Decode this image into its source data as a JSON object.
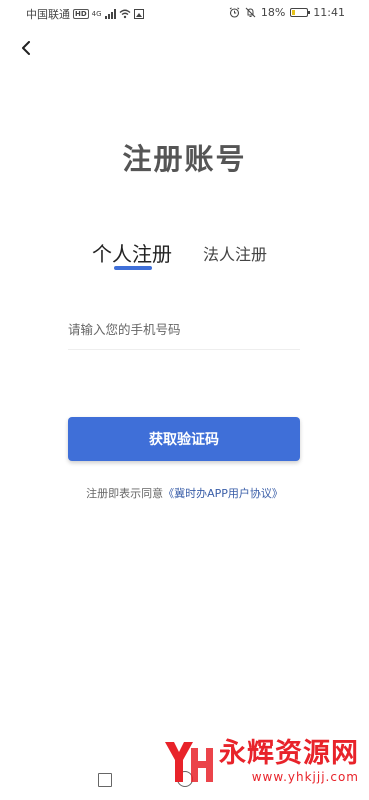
{
  "status_bar": {
    "carrier": "中国联通",
    "hd": "HD",
    "network": "4G",
    "battery": "18%",
    "battery_level": 0.18,
    "time": "11:41"
  },
  "header": {
    "back_icon": "chevron-left-icon"
  },
  "title": "注册账号",
  "tabs": [
    {
      "label": "个人注册",
      "active": true
    },
    {
      "label": "法人注册",
      "active": false
    }
  ],
  "phone_field": {
    "placeholder": "请输入您的手机号码",
    "value": ""
  },
  "get_code_button": {
    "label": "获取验证码"
  },
  "agreement": {
    "prefix": "注册即表示同意",
    "link": "《冀时办APP用户协议》"
  },
  "watermark": {
    "name": "永辉资源网",
    "url": "www.yhkjjj.com"
  },
  "colors": {
    "accent": "#3f6fd8",
    "link": "#3a5ea8",
    "watermark": "#e8232a"
  }
}
